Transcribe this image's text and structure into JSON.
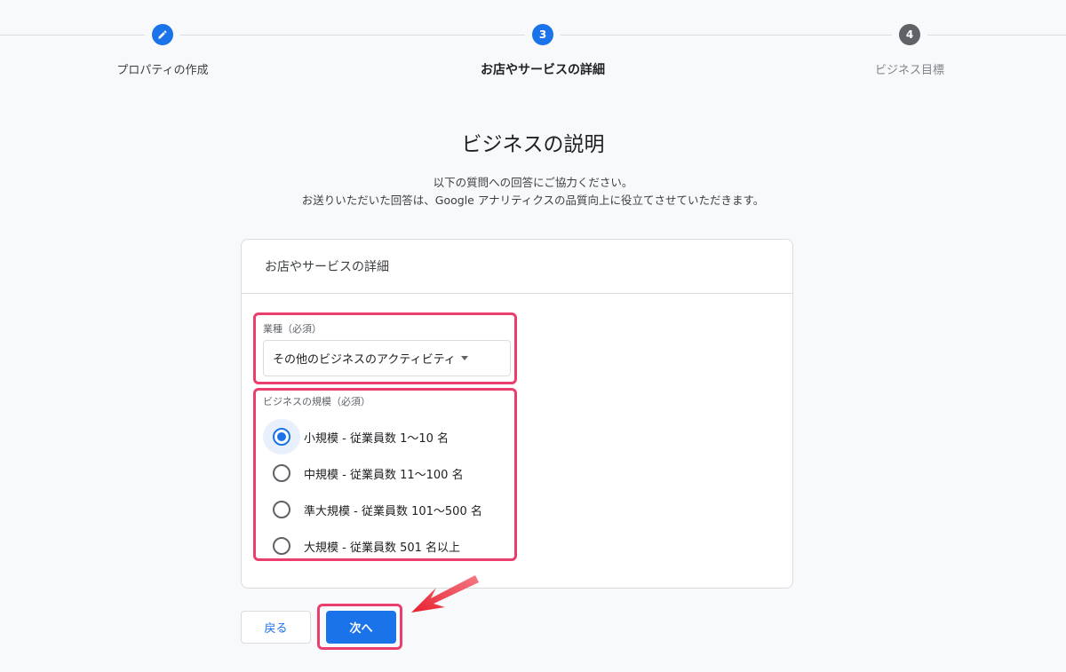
{
  "stepper": {
    "steps": [
      {
        "label": "プロパティの作成",
        "state": "done",
        "icon": "pencil-icon"
      },
      {
        "label": "お店やサービスの詳細",
        "state": "active",
        "number": "3"
      },
      {
        "label": "ビジネス目標",
        "state": "inactive",
        "number": "4"
      }
    ]
  },
  "page": {
    "title": "ビジネスの説明",
    "subtitle_line1": "以下の質問への回答にご協力ください。",
    "subtitle_line2": "お送りいただいた回答は、Google アナリティクスの品質向上に役立てさせていただきます。"
  },
  "card": {
    "header": "お店やサービスの詳細",
    "industry": {
      "label": "業種（必須）",
      "selected": "その他のビジネスのアクティビティ"
    },
    "size": {
      "label": "ビジネスの規模（必須）",
      "options": [
        {
          "label": "小規模 - 従業員数 1〜10 名",
          "checked": true
        },
        {
          "label": "中規模 - 従業員数 11〜100 名",
          "checked": false
        },
        {
          "label": "準大規模 - 従業員数 101〜500 名",
          "checked": false
        },
        {
          "label": "大規模 - 従業員数 501 名以上",
          "checked": false
        }
      ]
    }
  },
  "buttons": {
    "back": "戻る",
    "next": "次へ"
  },
  "colors": {
    "accent": "#1a73e8",
    "highlight": "#ea3e6e",
    "arrow": "#e8202f"
  }
}
